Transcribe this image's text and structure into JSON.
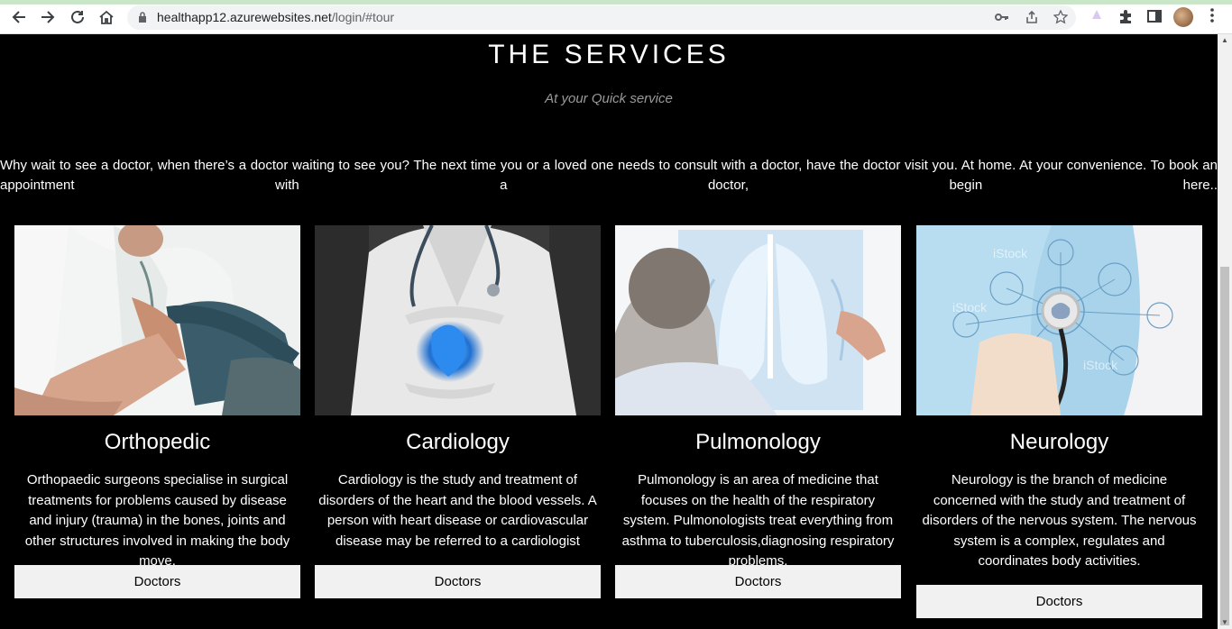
{
  "browser": {
    "url_host": "healthapp12.azurewebsites.net",
    "url_path": "/login/#tour"
  },
  "section": {
    "title": "THE SERVICES",
    "subtitle": "At your Quick service",
    "intro": "Why wait to see a doctor, when there’s a doctor waiting to see you? The next time you or a loved one needs to consult with a doctor, have the doctor visit you. At home. At your convenience. To book an appointment with a doctor, begin here.."
  },
  "cards": [
    {
      "title": "Orthopedic",
      "text": "Orthopaedic surgeons specialise in surgical treatments for problems caused by disease and injury (trauma) in the bones, joints and other structures involved in making the body move.",
      "button": "Doctors"
    },
    {
      "title": "Cardiology",
      "text": "Cardiology is the study and treatment of disorders of the heart and the blood vessels. A person with heart disease or cardiovascular disease may be referred to a cardiologist",
      "button": "Doctors"
    },
    {
      "title": "Pulmonology",
      "text": "Pulmonology is an area of medicine that focuses on the health of the respiratory system. Pulmonologists treat everything from asthma to tuberculosis,diagnosing respiratory problems.",
      "button": "Doctors"
    },
    {
      "title": "Neurology",
      "text": "Neurology is the branch of medicine concerned with the study and treatment of disorders of the nervous system. The nervous system is a complex, regulates and coordinates body activities.",
      "button": "Doctors"
    }
  ],
  "image_watermark": "iStock"
}
